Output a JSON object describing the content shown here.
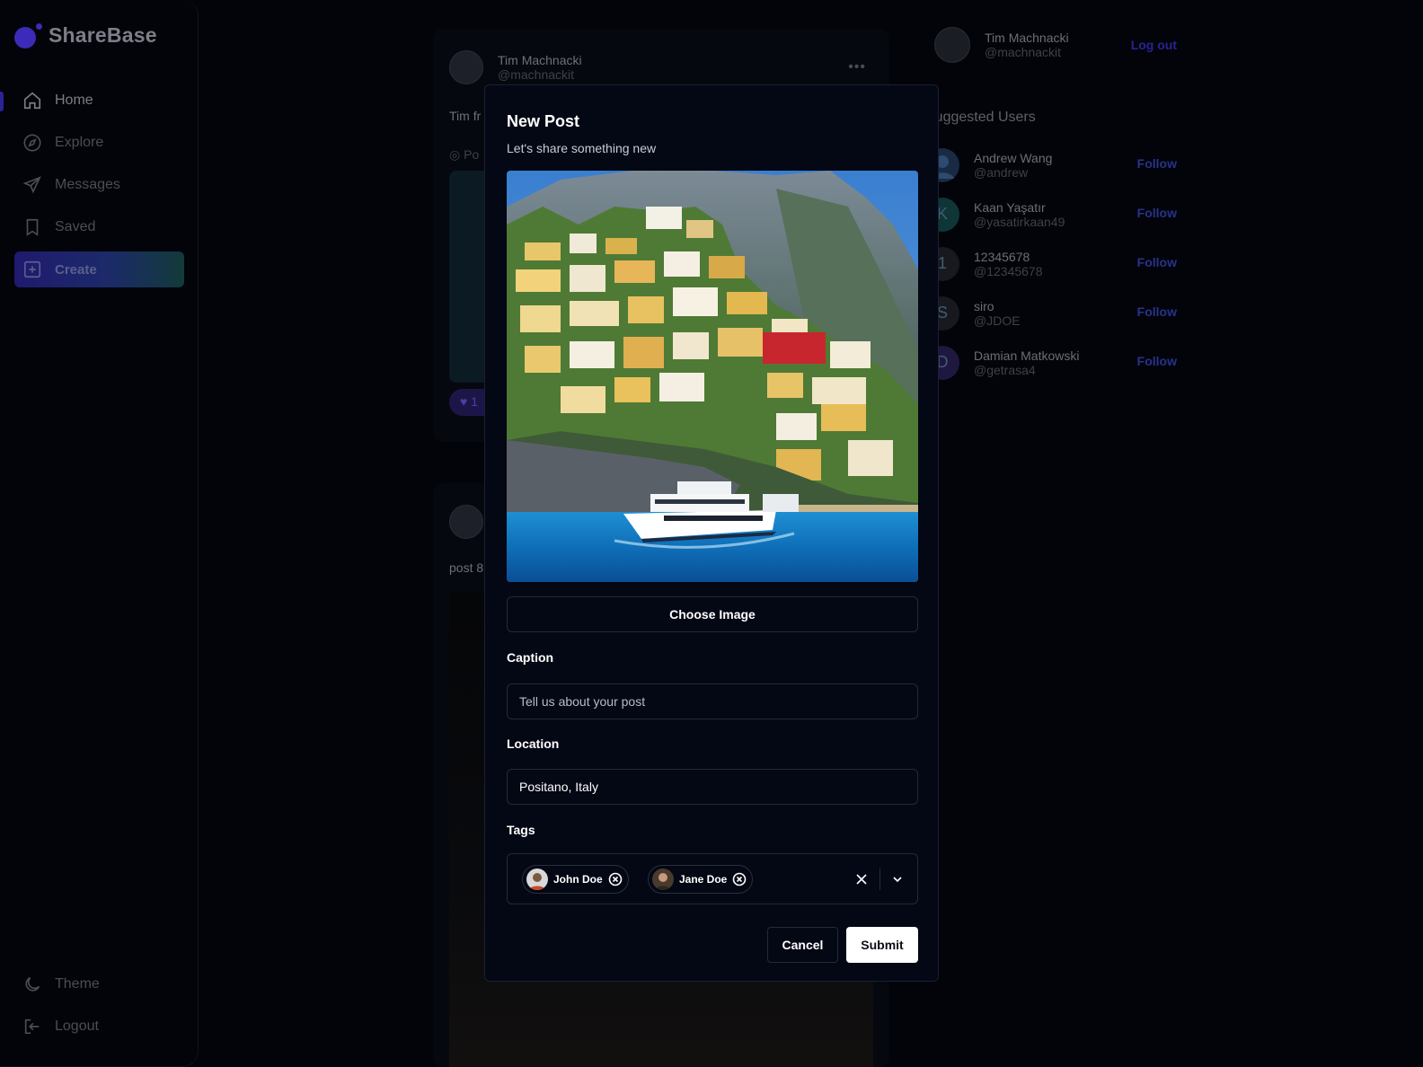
{
  "app": {
    "name": "ShareBase"
  },
  "sidebar": {
    "items": [
      {
        "label": "Home",
        "icon": "home-icon"
      },
      {
        "label": "Explore",
        "icon": "compass-icon"
      },
      {
        "label": "Messages",
        "icon": "send-icon"
      },
      {
        "label": "Saved",
        "icon": "bookmark-icon"
      },
      {
        "label": "Create",
        "icon": "plus-square-icon"
      }
    ],
    "bottom": [
      {
        "label": "Theme",
        "icon": "moon-icon"
      },
      {
        "label": "Logout",
        "icon": "logout-icon"
      }
    ]
  },
  "feed": {
    "post1": {
      "name": "Tim Machnacki",
      "handle": "@machnackit",
      "text": "Tim fr",
      "location": "Po",
      "likes": "1"
    },
    "post2": {
      "text": "post 8"
    }
  },
  "right": {
    "me": {
      "name": "Tim Machnacki",
      "handle": "@machnackit",
      "logout": "Log out"
    },
    "suggested_title": "Suggested Users",
    "follow_label": "Follow",
    "users": [
      {
        "name": "Andrew Wang",
        "handle": "@andrew",
        "initial": "",
        "color": "#1a2a44"
      },
      {
        "name": "Kaan Yaşatır",
        "handle": "@yasatirkaan49",
        "initial": "K",
        "color": "#0e3636"
      },
      {
        "name": "12345678",
        "handle": "@12345678",
        "initial": "1",
        "color": "#17191f"
      },
      {
        "name": "siro",
        "handle": "@JDOE",
        "initial": "S",
        "color": "#17191f"
      },
      {
        "name": "Damian Matkowski",
        "handle": "@getrasa4",
        "initial": "D",
        "color": "#1e1840"
      }
    ]
  },
  "modal": {
    "title": "New Post",
    "subtitle": "Let's share something new",
    "choose_image": "Choose Image",
    "caption": {
      "label": "Caption",
      "placeholder": "Tell us about your post",
      "value": ""
    },
    "location": {
      "label": "Location",
      "value": "Positano, Italy"
    },
    "tags": {
      "label": "Tags",
      "selected": [
        "John Doe",
        "Jane Doe"
      ]
    },
    "cancel": "Cancel",
    "submit": "Submit"
  }
}
